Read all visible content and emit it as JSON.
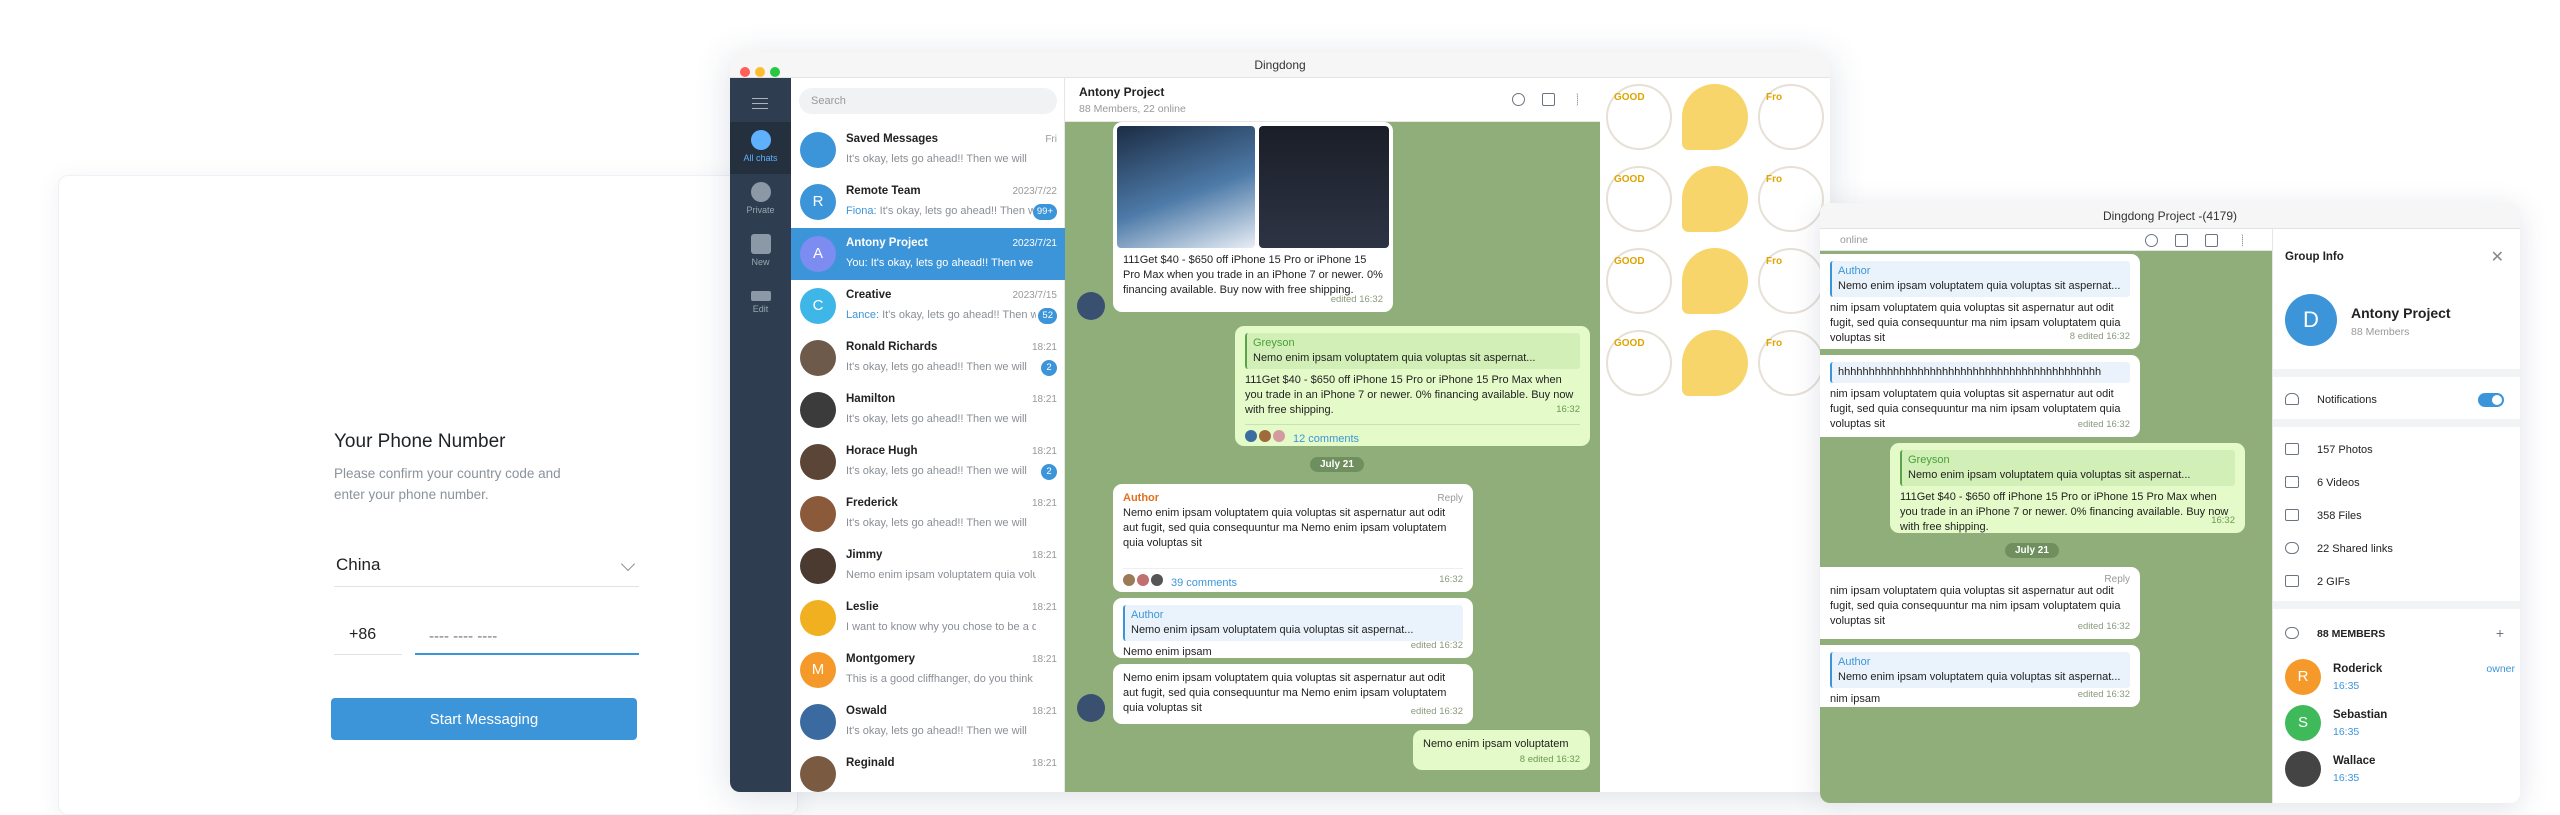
{
  "login": {
    "title": "Your Phone Number",
    "subtitle": "Please confirm your country code and enter your phone number.",
    "country": "China",
    "code": "+86",
    "phone_placeholder": "---- ---- ----",
    "button": "Start Messaging"
  },
  "main_window": {
    "title": "Dingdong",
    "rail": [
      "All chats",
      "Private",
      "New",
      "Edit"
    ],
    "search_placeholder": "Search",
    "chats": [
      {
        "name": "Saved Messages",
        "time": "Fri",
        "preview": "It's okay, lets go ahead!! Then we will",
        "sender": "",
        "badge": "",
        "avatar": "",
        "color": "#3d95d9"
      },
      {
        "name": "Remote Team",
        "time": "2023/7/22",
        "preview": "It's okay, lets go ahead!! Then we will",
        "sender": "Fiona:",
        "badge": "99+",
        "avatar": "R",
        "color": "#3d95d9"
      },
      {
        "name": "Antony Project",
        "time": "2023/7/21",
        "preview": "It's okay, lets go ahead!! Then we will",
        "sender": "You:",
        "badge": "",
        "avatar": "A",
        "color": "#7c8cf0"
      },
      {
        "name": "Creative",
        "time": "2023/7/15",
        "preview": "It's okay, lets go ahead!! Then we will",
        "sender": "Lance:",
        "badge": "52",
        "avatar": "C",
        "color": "#3fb6e8"
      },
      {
        "name": "Ronald Richards",
        "time": "18:21",
        "preview": "It's okay, lets go ahead!! Then we will",
        "sender": "",
        "badge": "2",
        "avatar": "",
        "color": "#6d5a4a"
      },
      {
        "name": "Hamilton",
        "time": "18:21",
        "preview": "It's okay, lets go ahead!! Then we will",
        "sender": "",
        "badge": "",
        "avatar": "",
        "color": "#3b3b3b"
      },
      {
        "name": "Horace Hugh",
        "time": "18:21",
        "preview": "It's okay, lets go ahead!! Then we will",
        "sender": "",
        "badge": "2",
        "avatar": "",
        "color": "#5a4536"
      },
      {
        "name": "Frederick",
        "time": "18:21",
        "preview": "It's okay, lets go ahead!! Then we will",
        "sender": "",
        "badge": "",
        "avatar": "",
        "color": "#8a5a3a"
      },
      {
        "name": "Jimmy",
        "time": "18:21",
        "preview": "Nemo enim ipsam voluptatem quia volup",
        "sender": "",
        "badge": "",
        "avatar": "",
        "color": "#4a3a30"
      },
      {
        "name": "Leslie",
        "time": "18:21",
        "preview": "I want to know why you chose to be a de",
        "sender": "",
        "badge": "",
        "avatar": "",
        "color": "#f0b020"
      },
      {
        "name": "Montgomery",
        "time": "18:21",
        "preview": "This is a good cliffhanger, do you think so?",
        "sender": "",
        "badge": "",
        "avatar": "M",
        "color": "#f59a2a"
      },
      {
        "name": "Oswald",
        "time": "18:21",
        "preview": "It's okay, lets go ahead!! Then we will",
        "sender": "",
        "badge": "",
        "avatar": "",
        "color": "#3a6aa0"
      },
      {
        "name": "Reginald",
        "time": "18:21",
        "preview": "",
        "sender": "",
        "badge": "",
        "avatar": "",
        "color": "#7a5a40"
      }
    ],
    "conversation": {
      "title": "Antony Project",
      "subtitle": "88 Members, 22 online",
      "msg1_text": "111Get $40 - $650 off iPhone 15 Pro or iPhone 15 Pro Max when you trade in an iPhone 7 or newer. 0% financing available. Buy now with free shipping.",
      "msg1_meta": "edited 16:32",
      "msg2_author": "Greyson",
      "msg2_quote": "Nemo enim ipsam voluptatem quia voluptas sit aspernat...",
      "msg2_text": "111Get $40 - $650 off iPhone 15 Pro or iPhone 15 Pro Max when you trade in an iPhone 7 or newer. 0% financing available. Buy now with free shipping.",
      "msg2_meta": "16:32",
      "msg2_comments": "12 comments",
      "date": "July 21",
      "msg3_author": "Author",
      "msg3_reply": "Reply",
      "msg3_text": "Nemo enim ipsam voluptatem quia voluptas sit aspernatur aut odit aut fugit, sed quia consequuntur ma Nemo enim ipsam voluptatem quia voluptas sit",
      "msg3_comments": "39 comments",
      "msg3_meta": "16:32",
      "msg4_author": "Author",
      "msg4_quote": "Nemo enim ipsam voluptatem quia voluptas sit aspernat...",
      "msg4_text": "Nemo enim ipsam",
      "msg4_meta": "edited 16:32",
      "msg5_text": "Nemo enim ipsam voluptatem quia voluptas sit aspernatur aut odit aut fugit, sed quia consequuntur ma Nemo enim ipsam voluptatem quia voluptas sit",
      "msg5_meta": "edited 16:32",
      "msg6_text": "Nemo enim ipsam voluptatem",
      "msg6_meta": "8  edited 16:32"
    },
    "stickers": [
      "GOOD",
      "Fro",
      "GOOD",
      "Fro",
      "GOOD",
      "Fro",
      "GOOD",
      "Fro"
    ]
  },
  "second_window": {
    "title": "Dingdong Project -(4179)",
    "online": "online",
    "msgs": {
      "q1_author": "Author",
      "q1_quote": "Nemo enim ipsam voluptatem quia voluptas sit aspernat...",
      "t1": "nim ipsam voluptatem quia voluptas sit aspernatur aut odit fugit, sed quia consequuntur ma nim ipsam voluptatem quia voluptas sit",
      "m1": "8  edited 16:32",
      "t2": "hhhhhhhhhhhhhhhhhhhhhhhhhhhhhhhhhhhhhhhhhhh",
      "t2b": "nim ipsam voluptatem quia voluptas sit aspernatur aut odit fugit, sed quia consequuntur ma nim ipsam voluptatem quia voluptas sit",
      "m2": "edited 16:32",
      "g_author": "Greyson",
      "g_quote": "Nemo enim ipsam voluptatem quia voluptas sit aspernat...",
      "g_text": "111Get $40 - $650 off iPhone 15 Pro or iPhone 15 Pro Max when you trade in an iPhone 7 or newer. 0% financing available. Buy now with free shipping.",
      "g_meta": "16:32",
      "date": "July 21",
      "r_reply": "Reply",
      "r_text": "nim ipsam voluptatem quia voluptas sit aspernatur aut odit fugit, sed quia consequuntur ma nim ipsam voluptatem quia voluptas sit",
      "r_meta": "edited 16:32",
      "q2_author": "Author",
      "q2_quote": "Nemo enim ipsam voluptatem quia voluptas sit aspernat...",
      "t3": "nim ipsam",
      "m3": "edited 16:32"
    },
    "info": {
      "header": "Group Info",
      "avatar": "D",
      "name": "Antony Project",
      "members": "88 Members",
      "notifications": "Notifications",
      "media": [
        "157 Photos",
        "6 Videos",
        "358 Files",
        "22 Shared links",
        "2 GIFs"
      ],
      "members_header": "88 MEMBERS",
      "list": [
        {
          "name": "Roderick",
          "time": "16:35",
          "role": "owner",
          "avatar": "R",
          "color": "#f59a2a"
        },
        {
          "name": "Sebastian",
          "time": "16:35",
          "role": "",
          "avatar": "S",
          "color": "#3fba5a"
        },
        {
          "name": "Wallace",
          "time": "16:35",
          "role": "",
          "avatar": "",
          "color": "#444"
        }
      ]
    }
  }
}
